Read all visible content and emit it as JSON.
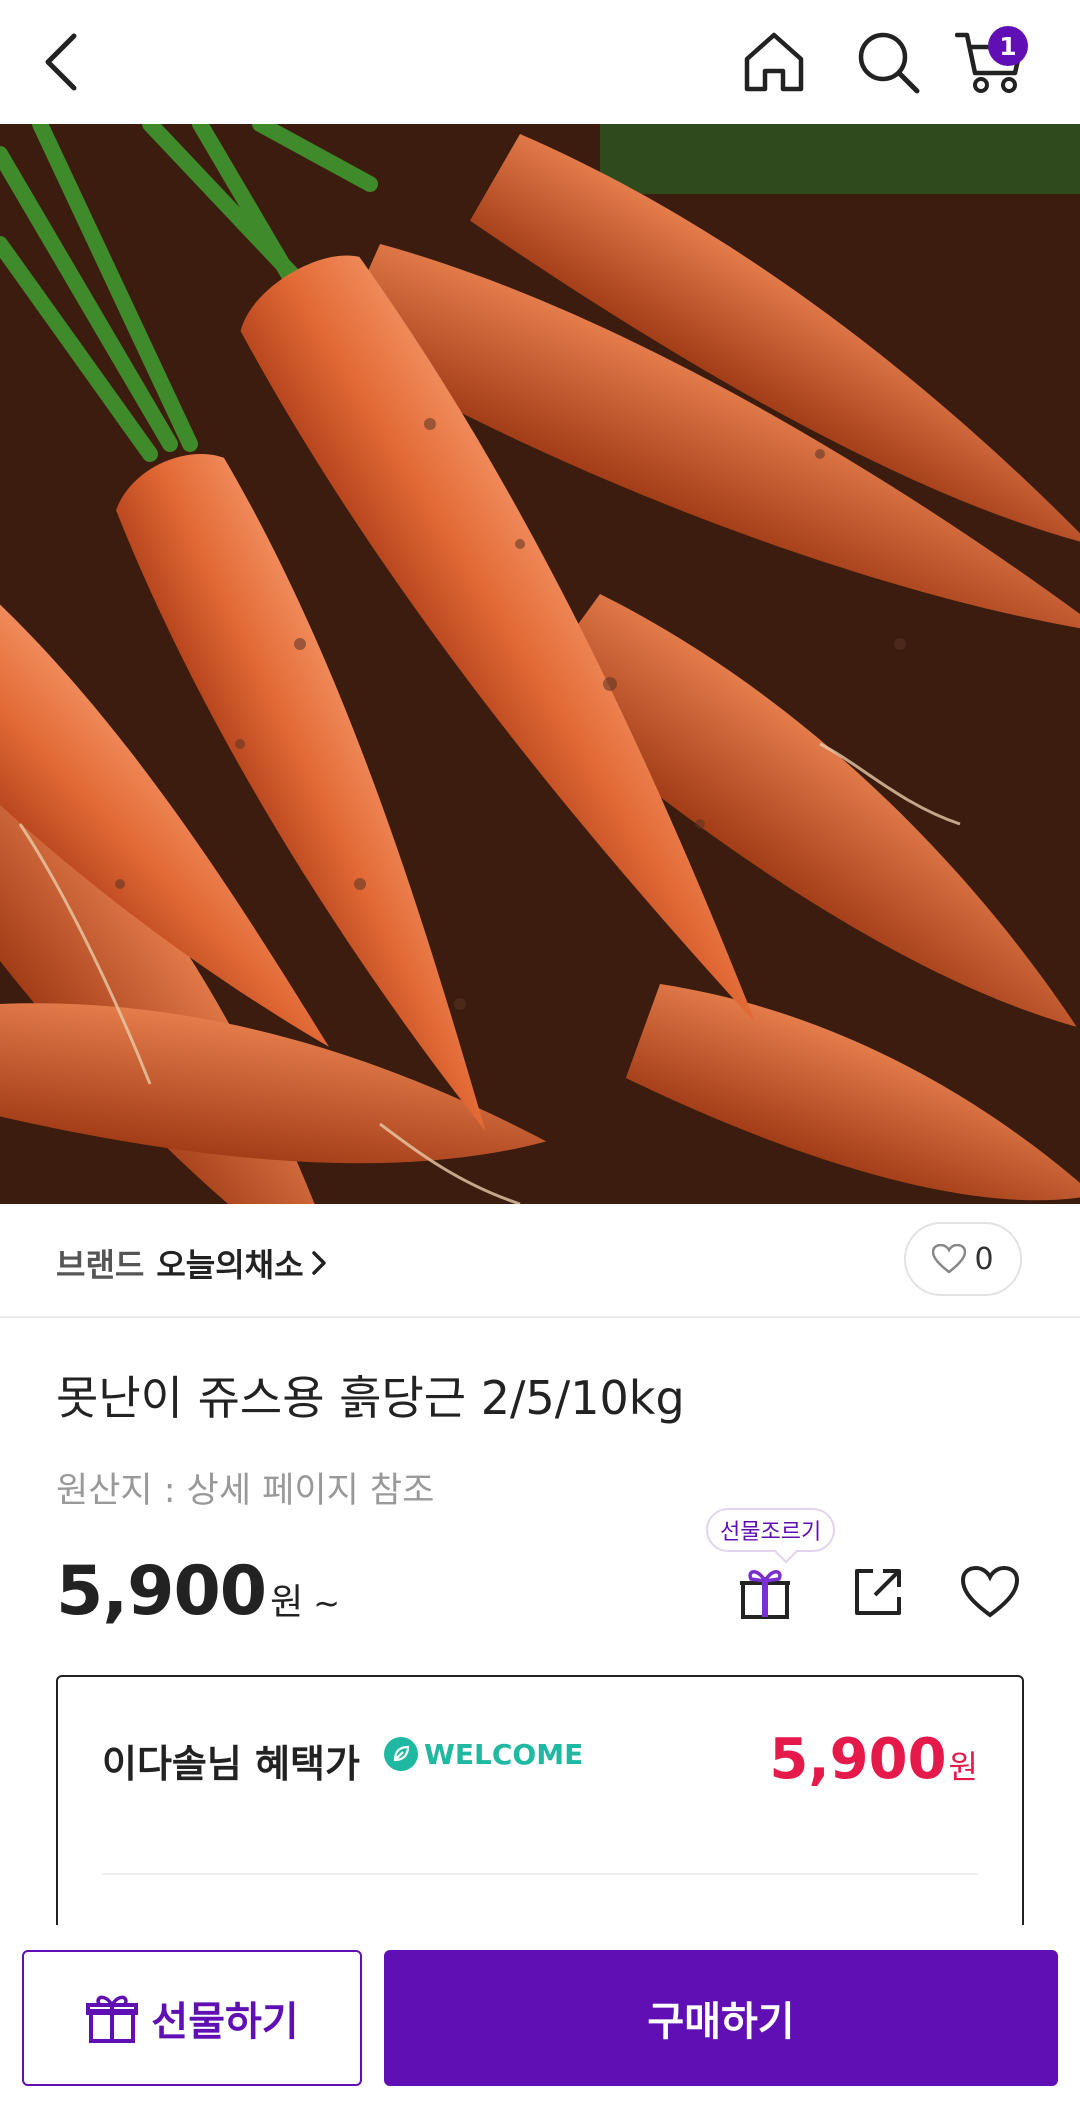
{
  "header": {
    "icons": [
      "back-arrow-icon",
      "home-icon",
      "search-icon",
      "cart-icon"
    ],
    "cart_count": "1"
  },
  "product": {
    "image_icon": "carrots-photo",
    "brand_prefix": "브랜드",
    "brand_name": "오늘의채소",
    "like_count": "0",
    "title": "못난이 쥬스용 흙당근 2/5/10kg",
    "origin": "원산지 : 상세 페이지 참조",
    "price": "5,900",
    "price_unit": "원",
    "price_suffix": "~",
    "gift_tooltip": "선물조르기"
  },
  "benefit": {
    "title": "이다솔님 혜택가",
    "badge": "WELCOME",
    "price": "5,900",
    "price_unit": "원"
  },
  "bottom": {
    "gift_label": "선물하기",
    "buy_label": "구매하기"
  },
  "colors": {
    "brand_purple": "#5f0fb4",
    "sale_red": "#e6194b",
    "welcome_teal": "#1fb8a0"
  }
}
